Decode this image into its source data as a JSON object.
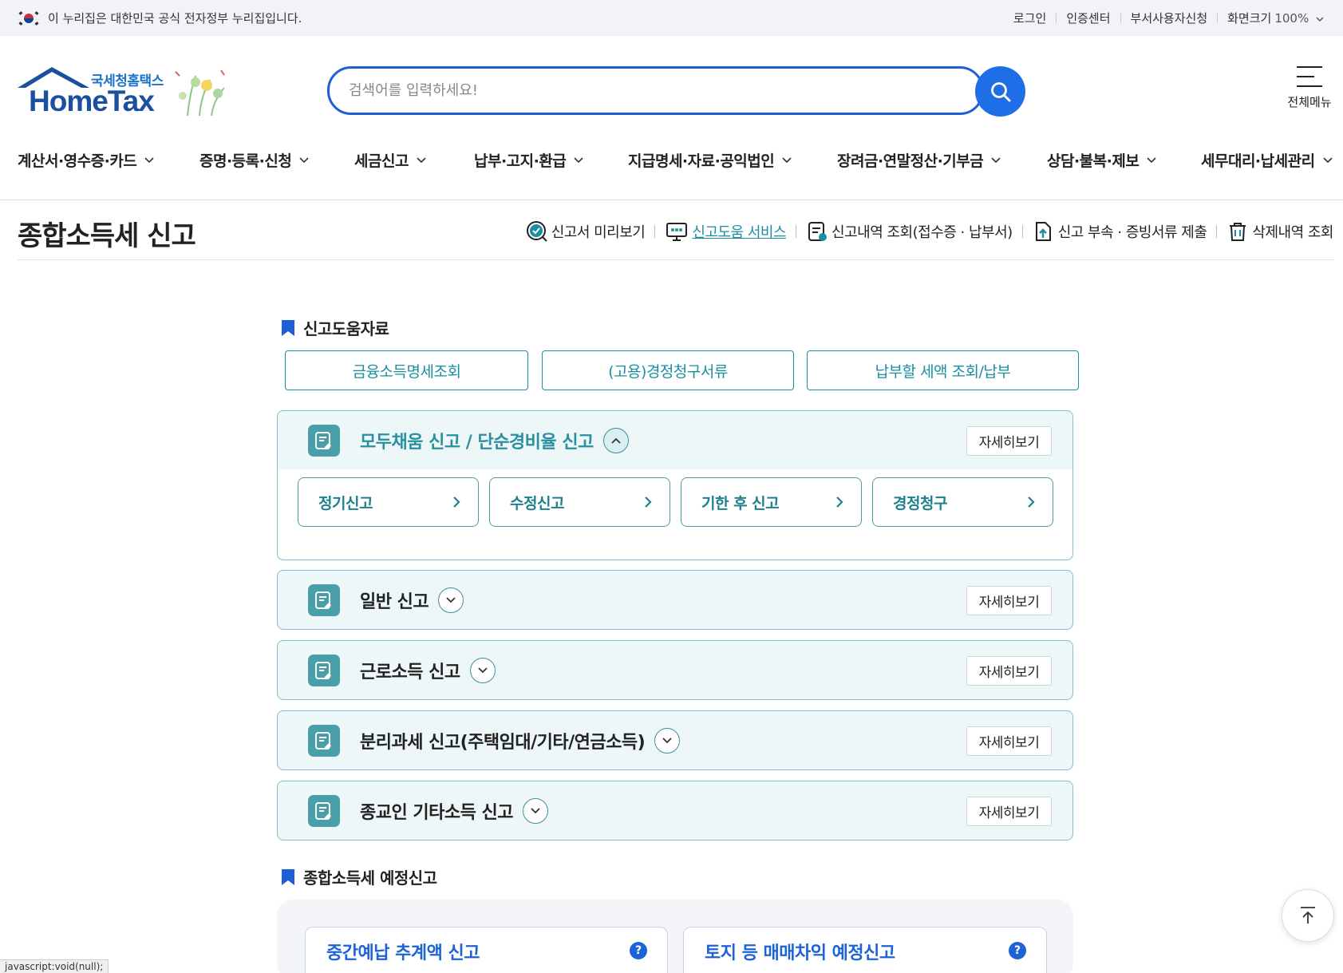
{
  "gov_banner": {
    "text": "이 누리집은 대한민국 공식 전자정부 누리집입니다.",
    "links": [
      "로그인",
      "인증센터",
      "부서사용자신청"
    ],
    "zoom_label": "화면크기",
    "zoom_value": "100%"
  },
  "header": {
    "logo_sub": "국세청홈택스",
    "logo_main": "HomeTax",
    "search_placeholder": "검색어를 입력하세요!",
    "all_menu_label": "전체메뉴"
  },
  "gnb": [
    "계산서·영수증·카드",
    "증명·등록·신청",
    "세금신고",
    "납부·고지·환급",
    "지급명세·자료·공익법인",
    "장려금·연말정산·기부금",
    "상담·불복·제보",
    "세무대리·납세관리"
  ],
  "page": {
    "title": "종합소득세 신고",
    "sub_links": [
      "신고서 미리보기",
      "신고도움 서비스",
      "신고내역 조회(접수증 · 납부서)",
      "신고 부속 · 증빙서류 제출",
      "삭제내역 조회"
    ]
  },
  "help_section": {
    "heading": "신고도움자료",
    "buttons": [
      "금융소득명세조회",
      "(고용)경정청구서류",
      "납부할 세액 조회/납부"
    ]
  },
  "accordions": [
    {
      "title": "모두채움 신고 / 단순경비율 신고",
      "detail": "자세히보기",
      "expanded": true,
      "sub": [
        "정기신고",
        "수정신고",
        "기한 후 신고",
        "경정청구"
      ]
    },
    {
      "title": "일반 신고",
      "detail": "자세히보기",
      "expanded": false
    },
    {
      "title": "근로소득 신고",
      "detail": "자세히보기",
      "expanded": false
    },
    {
      "title": "분리과세 신고(주택임대/기타/연금소득)",
      "detail": "자세히보기",
      "expanded": false
    },
    {
      "title": "종교인 기타소득 신고",
      "detail": "자세히보기",
      "expanded": false
    }
  ],
  "pre_section": {
    "heading": "종합소득세 예정신고",
    "cards": [
      {
        "title": "중간예납 추계액 신고",
        "help": "?"
      },
      {
        "title": "토지 등 매매차익 예정신고",
        "help": "?"
      }
    ]
  },
  "status_bar": "javascript:void(null);",
  "colors": {
    "accent_teal": "#1a8fa0",
    "brand_blue": "#1e5fd8"
  }
}
